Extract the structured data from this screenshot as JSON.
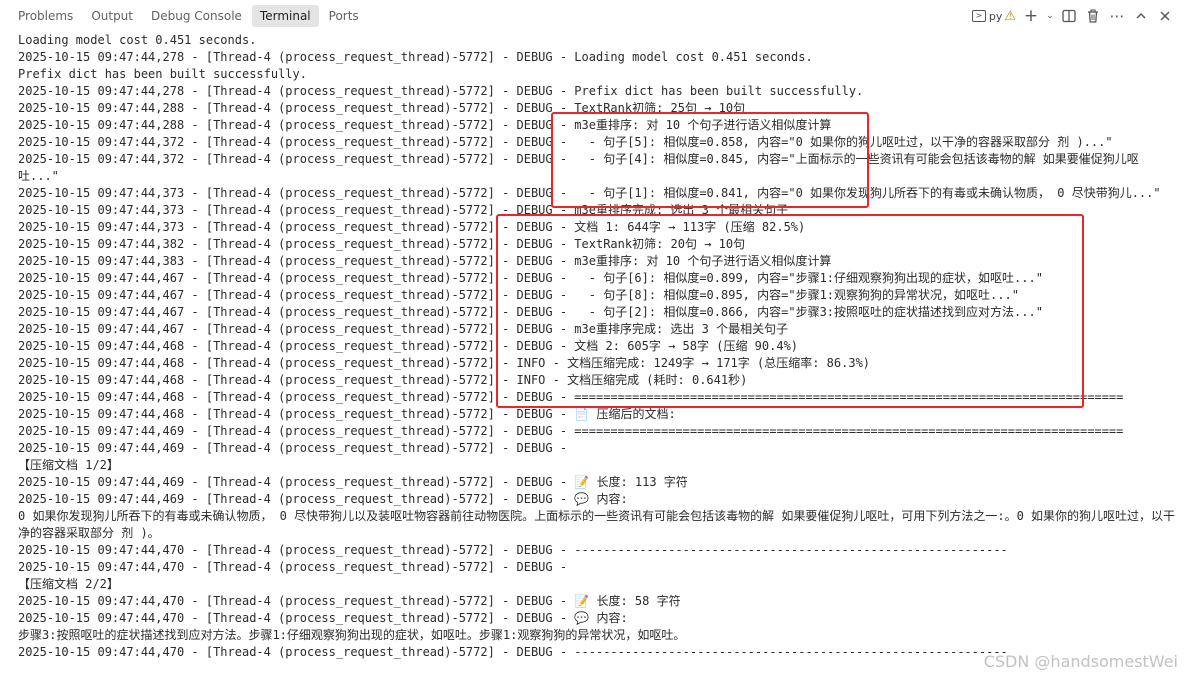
{
  "panel": {
    "tabs": [
      {
        "label": "Problems",
        "active": false
      },
      {
        "label": "Output",
        "active": false
      },
      {
        "label": "Debug Console",
        "active": false
      },
      {
        "label": "Terminal",
        "active": true
      },
      {
        "label": "Ports",
        "active": false
      }
    ],
    "terminal_name": "py",
    "icons": [
      "terminal-shell-icon",
      "warning-icon",
      "new-terminal-plus-icon",
      "chevron-down-icon",
      "split-terminal-icon",
      "trash-icon",
      "more-icon",
      "maximize-panel-icon",
      "close-icon"
    ]
  },
  "terminal": {
    "lines": [
      "Loading model cost 0.451 seconds.",
      "2025-10-15 09:47:44,278 - [Thread-4 (process_request_thread)-5772] - DEBUG - Loading model cost 0.451 seconds.",
      "Prefix dict has been built successfully.",
      "2025-10-15 09:47:44,278 - [Thread-4 (process_request_thread)-5772] - DEBUG - Prefix dict has been built successfully.",
      "2025-10-15 09:47:44,288 - [Thread-4 (process_request_thread)-5772] - DEBUG - TextRank初筛: 25句 → 10句",
      "2025-10-15 09:47:44,288 - [Thread-4 (process_request_thread)-5772] - DEBUG - m3e重排序: 对 10 个句子进行语义相似度计算",
      "2025-10-15 09:47:44,372 - [Thread-4 (process_request_thread)-5772] - DEBUG -   - 句子[5]: 相似度=0.858, 内容=\"0 如果你的狗儿呕吐过，以干净的容器采取部分 剂 )...\"",
      "2025-10-15 09:47:44,372 - [Thread-4 (process_request_thread)-5772] - DEBUG -   - 句子[4]: 相似度=0.845, 内容=\"上面标示的一些资讯有可能会包括该毒物的解 如果要催促狗儿呕吐...\"",
      "2025-10-15 09:47:44,373 - [Thread-4 (process_request_thread)-5772] - DEBUG -   - 句子[1]: 相似度=0.841, 内容=\"0 如果你发现狗儿所吞下的有毒或未确认物质， 0 尽快带狗儿...\"",
      "2025-10-15 09:47:44,373 - [Thread-4 (process_request_thread)-5772] - DEBUG - m3e重排序完成: 选出 3 个最相关句子",
      "2025-10-15 09:47:44,373 - [Thread-4 (process_request_thread)-5772] - DEBUG - 文档 1: 644字 → 113字 (压缩 82.5%)",
      "2025-10-15 09:47:44,382 - [Thread-4 (process_request_thread)-5772] - DEBUG - TextRank初筛: 20句 → 10句",
      "2025-10-15 09:47:44,383 - [Thread-4 (process_request_thread)-5772] - DEBUG - m3e重排序: 对 10 个句子进行语义相似度计算",
      "2025-10-15 09:47:44,467 - [Thread-4 (process_request_thread)-5772] - DEBUG -   - 句子[6]: 相似度=0.899, 内容=\"步骤1:仔细观察狗狗出现的症状，如呕吐...\"",
      "2025-10-15 09:47:44,467 - [Thread-4 (process_request_thread)-5772] - DEBUG -   - 句子[8]: 相似度=0.895, 内容=\"步骤1:观察狗狗的异常状况，如呕吐...\"",
      "2025-10-15 09:47:44,467 - [Thread-4 (process_request_thread)-5772] - DEBUG -   - 句子[2]: 相似度=0.866, 内容=\"步骤3:按照呕吐的症状描述找到应对方法...\"",
      "2025-10-15 09:47:44,467 - [Thread-4 (process_request_thread)-5772] - DEBUG - m3e重排序完成: 选出 3 个最相关句子",
      "2025-10-15 09:47:44,468 - [Thread-4 (process_request_thread)-5772] - DEBUG - 文档 2: 605字 → 58字 (压缩 90.4%)",
      "2025-10-15 09:47:44,468 - [Thread-4 (process_request_thread)-5772] - INFO - 文档压缩完成: 1249字 → 171字 (总压缩率: 86.3%)",
      "2025-10-15 09:47:44,468 - [Thread-4 (process_request_thread)-5772] - INFO - 文档压缩完成 (耗时: 0.641秒)",
      "2025-10-15 09:47:44,468 - [Thread-4 (process_request_thread)-5772] - DEBUG - ============================================================================",
      "2025-10-15 09:47:44,468 - [Thread-4 (process_request_thread)-5772] - DEBUG - 📄 压缩后的文档:",
      "2025-10-15 09:47:44,469 - [Thread-4 (process_request_thread)-5772] - DEBUG - ============================================================================",
      "2025-10-15 09:47:44,469 - [Thread-4 (process_request_thread)-5772] - DEBUG -",
      "【压缩文档 1/2】",
      "2025-10-15 09:47:44,469 - [Thread-4 (process_request_thread)-5772] - DEBUG - 📝 长度: 113 字符",
      "2025-10-15 09:47:44,469 - [Thread-4 (process_request_thread)-5772] - DEBUG - 💬 内容:",
      "0 如果你发现狗儿所吞下的有毒或未确认物质， 0 尽快带狗儿以及装呕吐物容器前往动物医院。上面标示的一些资讯有可能会包括该毒物的解 如果要催促狗儿呕吐，可用下列方法之一:。0 如果你的狗儿呕吐过，以干净的容器采取部分 剂 )。",
      "2025-10-15 09:47:44,470 - [Thread-4 (process_request_thread)-5772] - DEBUG - ------------------------------------------------------------",
      "2025-10-15 09:47:44,470 - [Thread-4 (process_request_thread)-5772] - DEBUG -",
      "【压缩文档 2/2】",
      "2025-10-15 09:47:44,470 - [Thread-4 (process_request_thread)-5772] - DEBUG - 📝 长度: 58 字符",
      "2025-10-15 09:47:44,470 - [Thread-4 (process_request_thread)-5772] - DEBUG - 💬 内容:",
      "步骤3:按照呕吐的症状描述找到应对方法。步骤1:仔细观察狗狗出现的症状，如呕吐。步骤1:观察狗狗的异常状况，如呕吐。",
      "2025-10-15 09:47:44,470 - [Thread-4 (process_request_thread)-5772] - DEBUG - ------------------------------------------------------------"
    ]
  },
  "watermark": "CSDN @handsomestWei",
  "highlight_color": "#e8262b"
}
